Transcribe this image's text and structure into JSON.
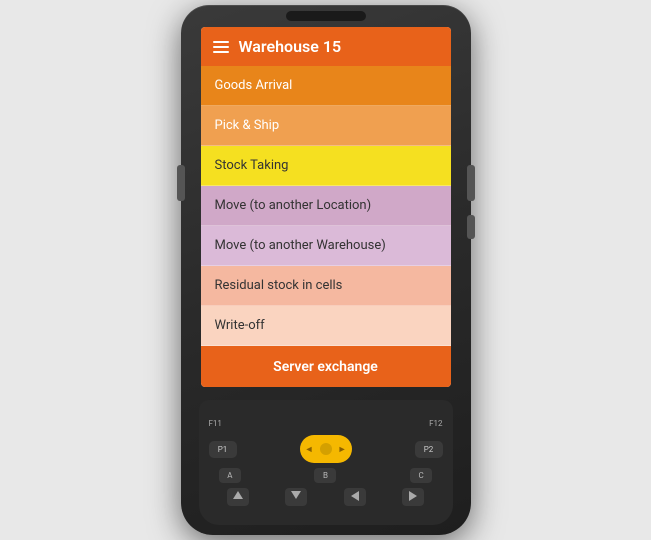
{
  "header": {
    "title": "Warehouse 15",
    "menu_icon": "hamburger-icon"
  },
  "menu_items": [
    {
      "id": "goods-arrival",
      "label": "Goods Arrival",
      "color_class": "item-goods-arrival"
    },
    {
      "id": "pick-ship",
      "label": "Pick & Ship",
      "color_class": "item-pick-ship"
    },
    {
      "id": "stock-taking",
      "label": "Stock Taking",
      "color_class": "item-stock-taking"
    },
    {
      "id": "move-location",
      "label": "Move (to another Location)",
      "color_class": "item-move-location"
    },
    {
      "id": "move-warehouse",
      "label": "Move (to another Warehouse)",
      "color_class": "item-move-warehouse"
    },
    {
      "id": "residual",
      "label": "Residual stock in cells",
      "color_class": "item-residual"
    },
    {
      "id": "writeoff",
      "label": "Write-off",
      "color_class": "item-writeoff"
    }
  ],
  "server_exchange_label": "Server exchange",
  "keypad": {
    "fn_labels": [
      "F11",
      "F12"
    ],
    "p_labels": [
      "P1",
      "P2"
    ],
    "alpha_labels": [
      "A",
      "B",
      "C"
    ],
    "nav_labels": [
      "▲",
      "▼",
      "◄",
      "►"
    ]
  }
}
